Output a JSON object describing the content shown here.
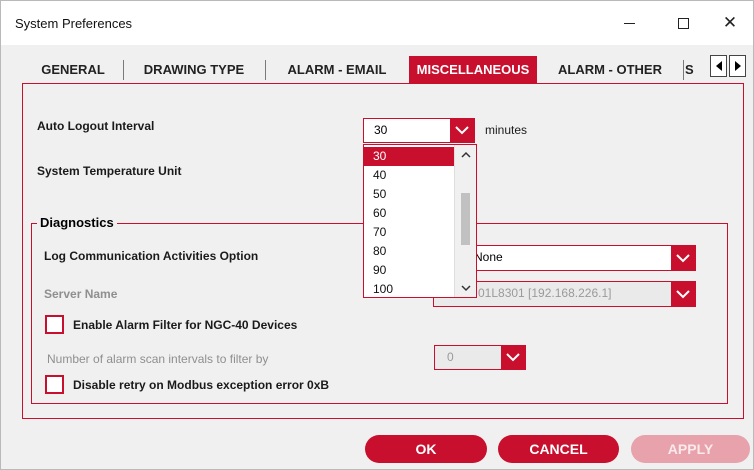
{
  "window": {
    "title": "System Preferences"
  },
  "tabs": [
    {
      "label": "GENERAL"
    },
    {
      "label": "DRAWING TYPE"
    },
    {
      "label": "ALARM - EMAIL"
    },
    {
      "label": "MISCELLANEOUS",
      "active": true
    },
    {
      "label": "ALARM - OTHER"
    },
    {
      "label": "S"
    }
  ],
  "general": {
    "auto_logout_label": "Auto Logout Interval",
    "auto_logout_value": "30",
    "auto_logout_unit": "minutes",
    "temperature_label": "System Temperature Unit"
  },
  "logout_options": [
    "30",
    "40",
    "50",
    "60",
    "70",
    "80",
    "90",
    "100"
  ],
  "logout_selected": "30",
  "diagnostics": {
    "title": "Diagnostics",
    "log_comm_label": "Log Communication Activities Option",
    "log_comm_value": "None",
    "server_label": "Server Name",
    "server_value": "01L8301 [192.168.226.1]",
    "alarm_filter_label": "Enable Alarm Filter for NGC-40 Devices",
    "alarm_filter_checked": false,
    "scan_intervals_label": "Number of alarm scan intervals to filter by",
    "scan_intervals_value": "0",
    "disable_retry_label": "Disable retry on Modbus exception error 0xB",
    "disable_retry_checked": false
  },
  "buttons": {
    "ok": "OK",
    "cancel": "CANCEL",
    "apply": "APPLY"
  },
  "colors": {
    "accent": "#c8102e",
    "disabled_accent": "#e8a2ac",
    "background": "#f0f0f0"
  },
  "icons": {
    "minimize": "minimize-icon",
    "maximize": "maximize-icon",
    "close": "close-icon",
    "dropdown": "chevron-down-icon",
    "tab_scroll_left": "arrow-left-icon",
    "tab_scroll_right": "arrow-right-icon"
  }
}
